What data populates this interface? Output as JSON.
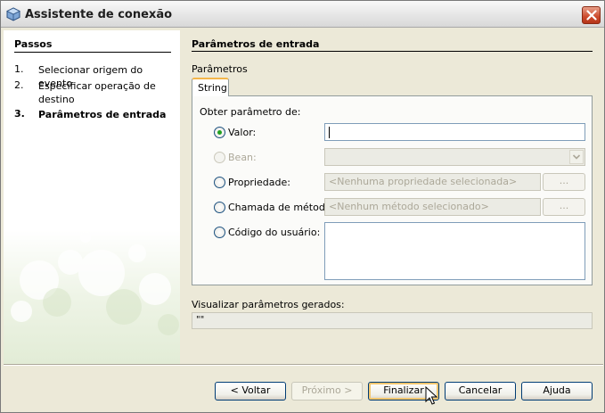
{
  "window": {
    "title": "Assistente de conexão"
  },
  "steps": {
    "heading": "Passos",
    "items": [
      {
        "num": "1.",
        "label": "Selecionar origem do evento"
      },
      {
        "num": "2.",
        "label": "Especificar operação de destino"
      },
      {
        "num": "3.",
        "label": "Parâmetros de entrada"
      }
    ]
  },
  "main": {
    "heading": "Parâmetros de entrada",
    "params_label": "Parâmetros",
    "tab": "String",
    "legend": "Obter parâmetro de:",
    "options": {
      "value": {
        "label": "Valor:",
        "input": ""
      },
      "bean": {
        "label": "Bean:"
      },
      "property": {
        "label": "Propriedade:",
        "placeholder": "<Nenhuma propriedade selecionada>",
        "button": "..."
      },
      "method": {
        "label": "Chamada de método:",
        "placeholder": "<Nenhum método selecionado>",
        "button": "..."
      },
      "user_code": {
        "label": "Código do usuário:"
      }
    },
    "preview_label": "Visualizar parâmetros gerados:",
    "preview_value": "\"\""
  },
  "buttons": {
    "back": "< Voltar",
    "next": "Próximo >",
    "finish": "Finalizar",
    "cancel": "Cancelar",
    "help": "Ajuda"
  }
}
